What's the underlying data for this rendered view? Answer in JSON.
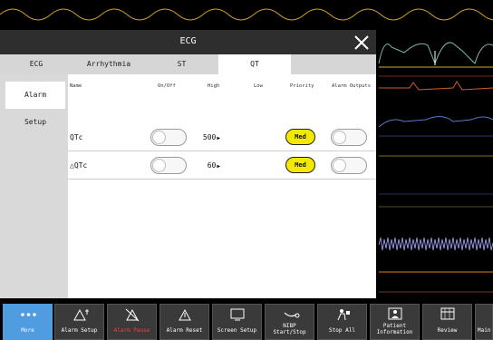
{
  "dialog": {
    "title": "ECG",
    "tabs": [
      {
        "label": "ECG"
      },
      {
        "label": "Arrhythmia"
      },
      {
        "label": "ST"
      },
      {
        "label": "QT",
        "active": true
      }
    ],
    "sidebar": [
      {
        "label": "Alarm",
        "active": true
      },
      {
        "label": "Setup"
      }
    ],
    "columns": {
      "name": "Name",
      "onoff": "On/Off",
      "high": "High",
      "low": "Low",
      "priority": "Priority",
      "outputs": "Alarm Outputs"
    },
    "rows": [
      {
        "name": "QTc",
        "on": false,
        "high": "500",
        "priority": "Med",
        "outputs": false
      },
      {
        "name": "△QTc",
        "on": false,
        "high": "60",
        "priority": "Med",
        "outputs": false
      }
    ]
  },
  "toolbar": {
    "more": "More",
    "alarm_setup": "Alarm Setup",
    "alarm_pause": "Alarm Pause",
    "alarm_reset": "Alarm Reset",
    "screen_setup": "Screen Setup",
    "nibp_line1": "NIBP",
    "nibp_line2": "Start/Stop",
    "stop_all": "Stop All",
    "patient_line1": "Patient",
    "patient_line2": "Information",
    "review": "Review",
    "menu": "Main"
  },
  "colors": {
    "priority_med": "#f2e800",
    "more_button": "#4f9de0",
    "alarm_pause_text": "#ff3b3b",
    "wave_yellow": "#d6a21a",
    "wave_teal": "#7fb8a8",
    "wave_red": "#d85a2a",
    "wave_blue": "#5a78c8",
    "wave_lavender": "#a8a8ff",
    "wave_orange": "#e07a1a"
  }
}
